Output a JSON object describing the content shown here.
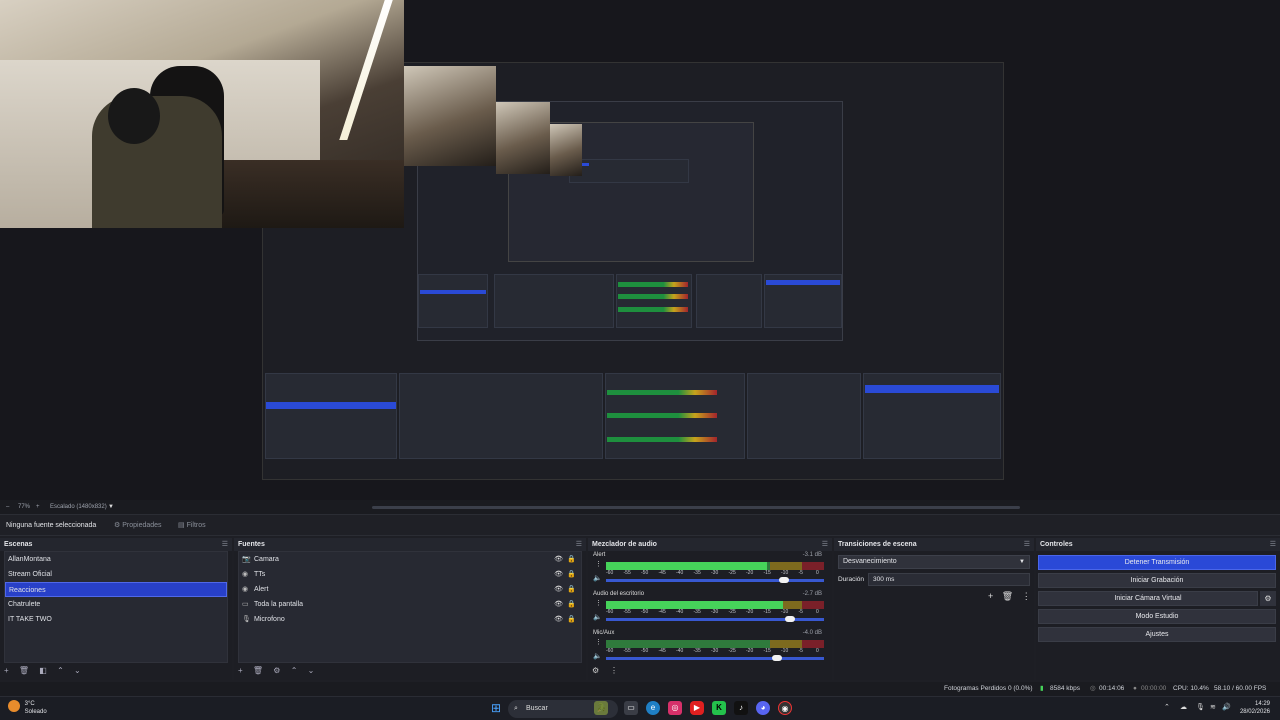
{
  "window": {
    "minimize": "–",
    "maximize": "☐",
    "close": "✕"
  },
  "zoom": {
    "minus": "–",
    "value": "77%",
    "plus": "+",
    "scaling": "Escalado (1480x832)",
    "caret": "▼"
  },
  "source_bar": {
    "label": "Ninguna fuente seleccionada",
    "properties": "Propiedades",
    "filters": "Filtros"
  },
  "scenes": {
    "title": "Escenas",
    "items": [
      "AllanMontana",
      "Stream Oficial",
      "Reacciones",
      "Chatrulete",
      "IT TAKE TWO"
    ],
    "selected": 2
  },
  "sources": {
    "title": "Fuentes",
    "items": [
      {
        "label": "Camara",
        "icon": "camera-icon"
      },
      {
        "label": "TTs",
        "icon": "browser-icon"
      },
      {
        "label": "Alert",
        "icon": "browser-icon"
      },
      {
        "label": "Toda la pantalla",
        "icon": "display-icon"
      },
      {
        "label": "Microfono",
        "icon": "microphone-icon"
      }
    ]
  },
  "mixer": {
    "title": "Mezclador de audio",
    "ticks": [
      "-60",
      "-55",
      "-50",
      "-45",
      "-40",
      "-35",
      "-30",
      "-25",
      "-20",
      "-15",
      "-10",
      "-5",
      "0"
    ],
    "channels": [
      {
        "name": "Alert",
        "db": "-3.1 dB",
        "level": 0.74,
        "volume": 0.83
      },
      {
        "name": "Audio del escritorio",
        "db": "-2.7 dB",
        "level": 0.81,
        "volume": 0.86
      },
      {
        "name": "Mic/Aux",
        "db": "-4.0 dB",
        "level": 0.0,
        "volume": 0.8
      }
    ]
  },
  "transitions": {
    "title": "Transiciones de escena",
    "selected": "Desvanecimiento",
    "duration_label": "Duración",
    "duration": "300 ms"
  },
  "controls": {
    "title": "Controles",
    "buttons": [
      "Detener Transmisión",
      "Iniciar Grabación",
      "Iniciar Cámara Virtual",
      "Modo Estudio",
      "Ajustes"
    ]
  },
  "status": {
    "dropped": "Fotogramas Perdidos 0 (0.0%)",
    "bitrate": "8584 kbps",
    "stream_time": "00:14:06",
    "rec_time": "00:00:00",
    "cpu": "CPU: 10.4%",
    "fps": "58.10 / 60.00 FPS"
  },
  "taskbar": {
    "weather_temp": "3°C",
    "weather_desc": "Soleado",
    "search": "Buscar",
    "time": "14:29",
    "date": "28/02/2026"
  },
  "colors": {
    "accent": "#2a49d7",
    "panel": "#1d1e24",
    "meter_green": "#46d35a",
    "meter_yellow": "#d7b52a",
    "meter_red": "#c22c3a"
  }
}
